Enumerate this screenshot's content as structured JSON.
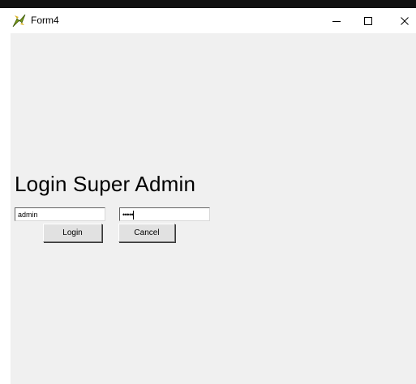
{
  "window": {
    "title": "Form4",
    "controls": {
      "minimize": "–",
      "maximize": "☐",
      "close": "✕"
    }
  },
  "form": {
    "heading": "Login Super Admin",
    "username_value": "admin",
    "password_value": "•••••",
    "login_label": "Login",
    "cancel_label": "Cancel"
  },
  "icons": {
    "app": "app-logo-icon"
  },
  "colors": {
    "form_background": "#f0f0f0",
    "titlebar_background": "#ffffff",
    "button_face": "#e1e1e1"
  }
}
